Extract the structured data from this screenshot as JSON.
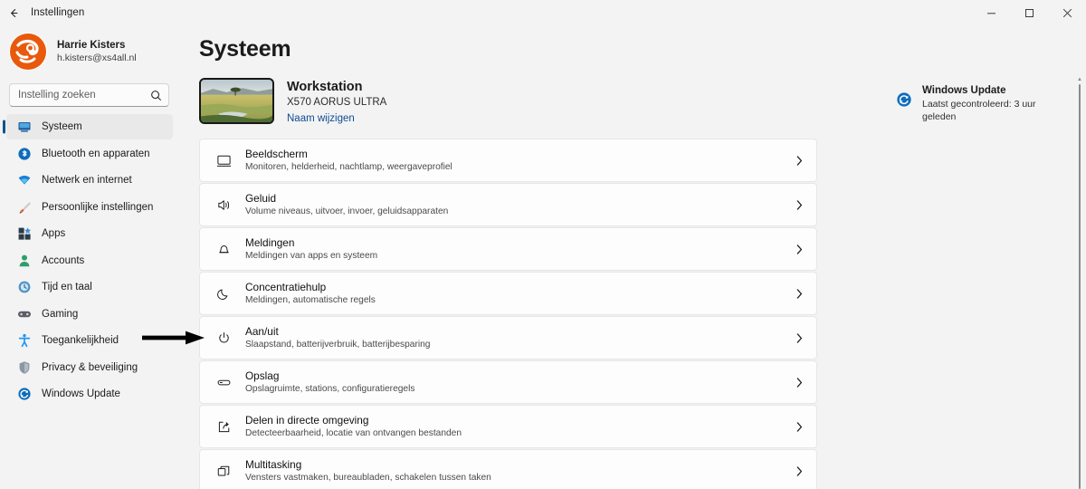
{
  "titlebar": {
    "back_label": "back-arrow",
    "title": "Instellingen",
    "minimize": "–",
    "maximize": "❑",
    "close": "✕"
  },
  "sidebar": {
    "account": {
      "name": "Harrie Kisters",
      "email": "h.kisters@xs4all.nl",
      "avatar_color": "#E8590C"
    },
    "search": {
      "placeholder": "Instelling zoeken",
      "value": "",
      "icon": "search-icon"
    },
    "items": [
      {
        "label": "Systeem",
        "icon": "monitor-icon",
        "active": true,
        "color": "#0f6cbd"
      },
      {
        "label": "Bluetooth en apparaten",
        "icon": "bluetooth-icon",
        "active": false,
        "color": "#0f6cbd"
      },
      {
        "label": "Netwerk en internet",
        "icon": "network-icon",
        "active": false,
        "color": "#1b7fd4"
      },
      {
        "label": "Persoonlijke instellingen",
        "icon": "brush-icon",
        "active": false,
        "color": "#d9622b"
      },
      {
        "label": "Apps",
        "icon": "apps-icon",
        "active": false,
        "color": "#2b3a45"
      },
      {
        "label": "Accounts",
        "icon": "person-icon",
        "active": false,
        "color": "#2e9e6b"
      },
      {
        "label": "Tijd en taal",
        "icon": "clock-globe-icon",
        "active": false,
        "color": "#4b93c9"
      },
      {
        "label": "Gaming",
        "icon": "gamepad-icon",
        "active": false,
        "color": "#5c5c66"
      },
      {
        "label": "Toegankelijkheid",
        "icon": "accessibility-icon",
        "active": false,
        "color": "#2196f3"
      },
      {
        "label": "Privacy & beveiliging",
        "icon": "shield-icon",
        "active": false,
        "color": "#7a8894"
      },
      {
        "label": "Windows Update",
        "icon": "update-icon",
        "active": false,
        "color": "#0f6cbd"
      }
    ]
  },
  "main": {
    "page_title": "Systeem",
    "device": {
      "name": "Workstation",
      "model": "X570 AORUS ULTRA",
      "rename_link": "Naam wijzigen",
      "thumbnail": "savanna-landscape-photo"
    },
    "windows_update": {
      "title": "Windows Update",
      "subtitle": "Laatst gecontroleerd: 3 uur geleden",
      "icon": "update-icon",
      "icon_color": "#0f6cbd"
    },
    "settings": [
      {
        "title": "Beeldscherm",
        "subtitle": "Monitoren, helderheid, nachtlamp, weergaveprofiel",
        "icon": "display-icon"
      },
      {
        "title": "Geluid",
        "subtitle": "Volume niveaus, uitvoer, invoer, geluidsapparaten",
        "icon": "speaker-icon"
      },
      {
        "title": "Meldingen",
        "subtitle": "Meldingen van apps en systeem",
        "icon": "bell-icon"
      },
      {
        "title": "Concentratiehulp",
        "subtitle": "Meldingen, automatische regels",
        "icon": "moon-icon"
      },
      {
        "title": "Aan/uit",
        "subtitle": "Slaapstand, batterijverbruik, batterijbesparing",
        "icon": "power-icon"
      },
      {
        "title": "Opslag",
        "subtitle": "Opslagruimte, stations, configuratieregels",
        "icon": "storage-icon"
      },
      {
        "title": "Delen in directe omgeving",
        "subtitle": "Detecteerbaarheid, locatie van ontvangen bestanden",
        "icon": "share-icon"
      },
      {
        "title": "Multitasking",
        "subtitle": "Vensters vastmaken, bureaubladen, schakelen tussen taken",
        "icon": "multitasking-icon"
      }
    ],
    "chevron": "›"
  },
  "annotation": {
    "arrow_target": "Aan/uit",
    "arrow_color": "#000000"
  }
}
